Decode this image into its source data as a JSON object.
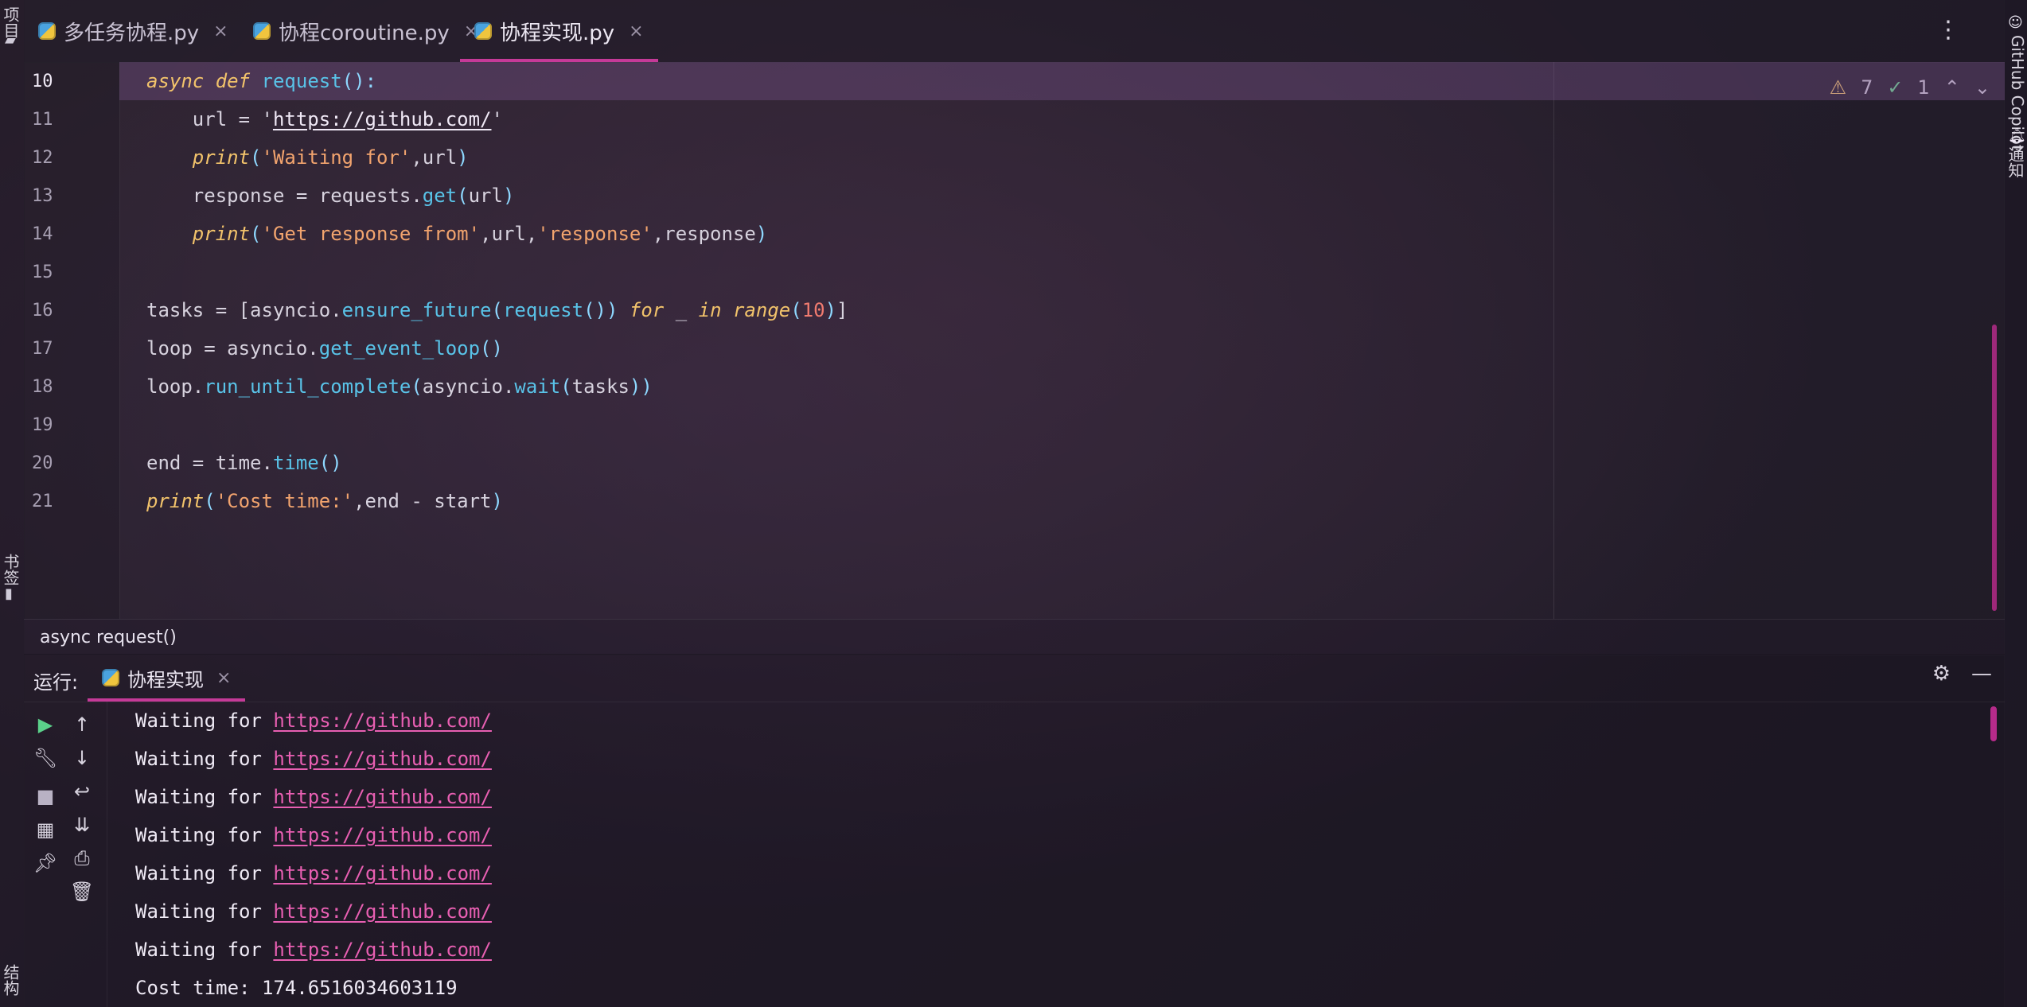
{
  "left_sidebar": {
    "project_label": "项目",
    "bookmarks_label": "书签",
    "structure_label": "结构"
  },
  "right_sidebar": {
    "copilot_label": "GitHub Copilot",
    "notifications_label": "通知"
  },
  "tabs": [
    {
      "label": "多任务协程.py",
      "active": false
    },
    {
      "label": "协程coroutine.py",
      "active": false
    },
    {
      "label": "协程实现.py",
      "active": true
    }
  ],
  "editor": {
    "inspection": {
      "warnings": "7",
      "ok": "1"
    },
    "lines": [
      {
        "n": "10",
        "segments": [
          [
            "k",
            "async"
          ],
          [
            "t",
            " "
          ],
          [
            "k",
            "def"
          ],
          [
            "t",
            " "
          ],
          [
            "f",
            "request"
          ],
          [
            "p",
            "():"
          ]
        ]
      },
      {
        "n": "11",
        "segments": [
          [
            "t",
            "    url = '"
          ],
          [
            "u",
            "https://github.com/"
          ],
          [
            "t",
            "'"
          ]
        ]
      },
      {
        "n": "12",
        "segments": [
          [
            "t",
            "    "
          ],
          [
            "k",
            "print"
          ],
          [
            "p",
            "("
          ],
          [
            "s",
            "'Waiting for'"
          ],
          [
            "t",
            ","
          ],
          [
            "t",
            "url"
          ],
          [
            "p",
            ")"
          ]
        ]
      },
      {
        "n": "13",
        "segments": [
          [
            "t",
            "    response = requests."
          ],
          [
            "f",
            "get"
          ],
          [
            "p",
            "("
          ],
          [
            "t",
            "url"
          ],
          [
            "p",
            ")"
          ]
        ]
      },
      {
        "n": "14",
        "segments": [
          [
            "t",
            "    "
          ],
          [
            "k",
            "print"
          ],
          [
            "p",
            "("
          ],
          [
            "s",
            "'Get response from'"
          ],
          [
            "t",
            ",url,"
          ],
          [
            "s",
            "'response'"
          ],
          [
            "t",
            ",response"
          ],
          [
            "p",
            ")"
          ]
        ]
      },
      {
        "n": "15",
        "segments": [
          [
            "t",
            ""
          ]
        ]
      },
      {
        "n": "16",
        "segments": [
          [
            "t",
            "tasks = [asyncio."
          ],
          [
            "f",
            "ensure_future"
          ],
          [
            "p",
            "("
          ],
          [
            "f",
            "request"
          ],
          [
            "p",
            "())"
          ],
          [
            "t",
            " "
          ],
          [
            "k",
            "for"
          ],
          [
            "t",
            " _ "
          ],
          [
            "k",
            "in"
          ],
          [
            "t",
            " "
          ],
          [
            "k",
            "range"
          ],
          [
            "p",
            "("
          ],
          [
            "n",
            "10"
          ],
          [
            "p",
            ")"
          ],
          [
            "t",
            "]"
          ]
        ]
      },
      {
        "n": "17",
        "segments": [
          [
            "t",
            "loop = asyncio."
          ],
          [
            "f",
            "get_event_loop"
          ],
          [
            "p",
            "()"
          ]
        ]
      },
      {
        "n": "18",
        "segments": [
          [
            "t",
            "loop."
          ],
          [
            "f",
            "run_until_complete"
          ],
          [
            "p",
            "("
          ],
          [
            "t",
            "asyncio."
          ],
          [
            "f",
            "wait"
          ],
          [
            "p",
            "("
          ],
          [
            "t",
            "tasks"
          ],
          [
            "p",
            "))"
          ]
        ]
      },
      {
        "n": "19",
        "segments": [
          [
            "t",
            ""
          ]
        ]
      },
      {
        "n": "20",
        "segments": [
          [
            "t",
            "end = time."
          ],
          [
            "f",
            "time"
          ],
          [
            "p",
            "()"
          ]
        ]
      },
      {
        "n": "21",
        "segments": [
          [
            "k",
            "print"
          ],
          [
            "p",
            "("
          ],
          [
            "s",
            "'Cost time:'"
          ],
          [
            "t",
            ",end - start"
          ],
          [
            "p",
            ")"
          ]
        ]
      }
    ]
  },
  "breadcrumb": "async request()",
  "run": {
    "label": "运行:",
    "tab_label": "协程实现",
    "output": [
      {
        "prefix": "Waiting for ",
        "link": "https://github.com/"
      },
      {
        "prefix": "Waiting for ",
        "link": "https://github.com/"
      },
      {
        "prefix": "Waiting for ",
        "link": "https://github.com/"
      },
      {
        "prefix": "Waiting for ",
        "link": "https://github.com/"
      },
      {
        "prefix": "Waiting for ",
        "link": "https://github.com/"
      },
      {
        "prefix": "Waiting for ",
        "link": "https://github.com/"
      },
      {
        "prefix": "Waiting for ",
        "link": "https://github.com/"
      },
      {
        "prefix": "Cost time: 174.6516034603119",
        "link": ""
      }
    ]
  },
  "colors": {
    "accent": "#c53a98",
    "keyword": "#f2c36b",
    "function": "#59c3e8",
    "string": "#f2a46e",
    "number": "#f07b6f"
  },
  "icons": {
    "python_file": "python-file-icon",
    "close": "close-icon",
    "more": "more-vertical-icon",
    "warning": "warning-icon",
    "check": "check-icon",
    "up": "chevron-up-icon",
    "down": "chevron-down-icon",
    "gear": "gear-icon",
    "minimize": "minimize-icon",
    "run": "run-icon",
    "wrench": "wrench-icon",
    "stop": "stop-icon",
    "layout": "layout-icon",
    "pin": "pin-icon",
    "arrow_up": "arrow-up-icon",
    "arrow_down": "arrow-down-icon",
    "soft_wrap": "soft-wrap-icon",
    "scroll_end": "scroll-to-end-icon",
    "print": "print-icon",
    "trash": "trash-icon",
    "copilot": "copilot-icon",
    "bell": "bell-icon",
    "folder": "folder-icon",
    "bookmark": "bookmark-icon"
  }
}
